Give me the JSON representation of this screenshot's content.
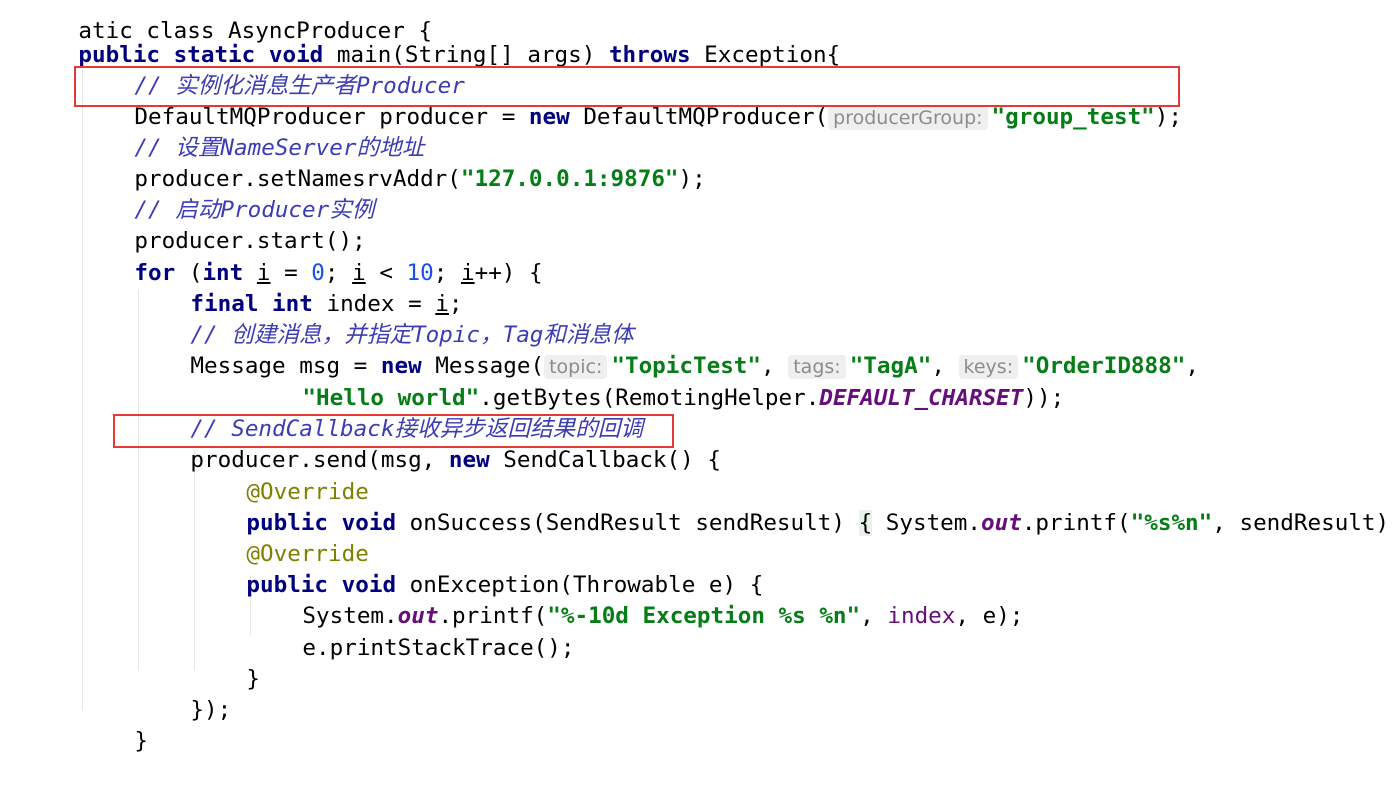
{
  "colors": {
    "keyword": "#000080",
    "comment": "#3c3cb4",
    "string": "#067d17",
    "number": "#1750eb",
    "annotation": "#808000",
    "field": "#660e7a",
    "highlight_box": "#e53935"
  },
  "code": {
    "l0": {
      "text": "atic class AsyncProducer {"
    },
    "l1": {
      "kw1": "public static void",
      "rest": " main(String[] args) ",
      "kw2": "throws",
      "rest2": " Exception{"
    },
    "l2": {
      "comment": "// 实例化消息生产者Producer"
    },
    "l3": {
      "pre": "DefaultMQProducer producer = ",
      "kw": "new",
      "mid": " DefaultMQProducer(",
      "hint": "producerGroup:",
      "str": "\"group_test\"",
      "end": ");"
    },
    "l4": {
      "comment": "// 设置NameServer的地址"
    },
    "l5": {
      "pre": "producer.setNamesrvAddr(",
      "str": "\"127.0.0.1:9876\"",
      "end": ");"
    },
    "l6": {
      "comment": "// 启动Producer实例"
    },
    "l7": {
      "text": "producer.start();"
    },
    "l8": {
      "kw1": "for",
      "p1": " (",
      "kw2": "int",
      "sp": " ",
      "i1": "i",
      "p2": " = ",
      "n1": "0",
      "p3": "; ",
      "i2": "i",
      "p4": " < ",
      "n2": "10",
      "p5": "; ",
      "i3": "i",
      "p6": "++) {"
    },
    "l9": {
      "kw": "final int",
      "mid": " index = ",
      "i": "i",
      "end": ";"
    },
    "l10": {
      "comment": "// 创建消息，并指定Topic，Tag和消息体"
    },
    "l11": {
      "pre": "Message msg = ",
      "kw": "new",
      "mid": " Message(",
      "h1": "topic:",
      "s1": "\"TopicTest\"",
      "c1": ", ",
      "h2": "tags:",
      "s2": "\"TagA\"",
      "c2": ", ",
      "h3": "keys:",
      "s3": "\"OrderID888\"",
      "end": ","
    },
    "l12": {
      "str": "\"Hello world\"",
      "mid": ".getBytes(RemotingHelper.",
      "field": "DEFAULT_CHARSET",
      "end": "));"
    },
    "l13": {
      "comment": "// SendCallback接收异步返回结果的回调"
    },
    "l14": {
      "pre": "producer.send(msg, ",
      "kw": "new",
      "end": " SendCallback() {"
    },
    "l15": {
      "ann": "@Override"
    },
    "l16": {
      "kw": "public void",
      "mid": " onSuccess(SendResult sendResult) ",
      "brace": "{",
      "mid2": " System.",
      "field": "out",
      "mid3": ".printf(",
      "str": "\"%s%n\"",
      "end": ", sendResult);"
    },
    "l17": {
      "ann": "@Override"
    },
    "l18": {
      "kw": "public void",
      "end": " onException(Throwable e) {"
    },
    "l19": {
      "pre": "System.",
      "field": "out",
      "mid": ".printf(",
      "str": "\"%-10d Exception %s %n\"",
      "c": ", ",
      "var": "index",
      "end": ", e);"
    },
    "l20": {
      "text": "e.printStackTrace();"
    },
    "l21": {
      "text": "}"
    },
    "l22": {
      "text": "});"
    },
    "l23": {
      "text": "}"
    }
  }
}
